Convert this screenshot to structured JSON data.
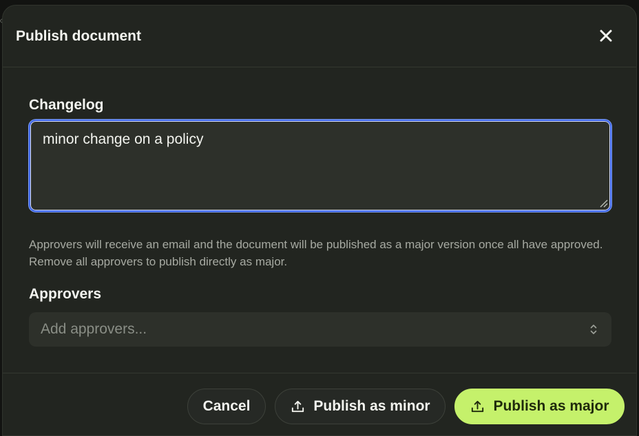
{
  "dialog": {
    "title": "Publish document",
    "close_label": "Close"
  },
  "changelog": {
    "label": "Changelog",
    "value": "minor change on a policy"
  },
  "helper_text": "Approvers will receive an email and the document will be published as a major version once all have approved. Remove all approvers to publish directly as major.",
  "approvers": {
    "label": "Approvers",
    "placeholder": "Add approvers..."
  },
  "footer": {
    "cancel_label": "Cancel",
    "publish_minor_label": "Publish as minor",
    "publish_major_label": "Publish as major"
  },
  "icons": {
    "close": "close-icon",
    "resize": "resize-handle-icon",
    "selector": "chevron-up-down-icon",
    "upload": "upload-icon"
  },
  "colors": {
    "dialog_background": "#222520",
    "input_background": "#2d302a",
    "focus_ring": "#3f67e8",
    "primary_accent": "#c5f16b",
    "text": "#f4f5f0",
    "muted_text": "#a7aaa2"
  }
}
